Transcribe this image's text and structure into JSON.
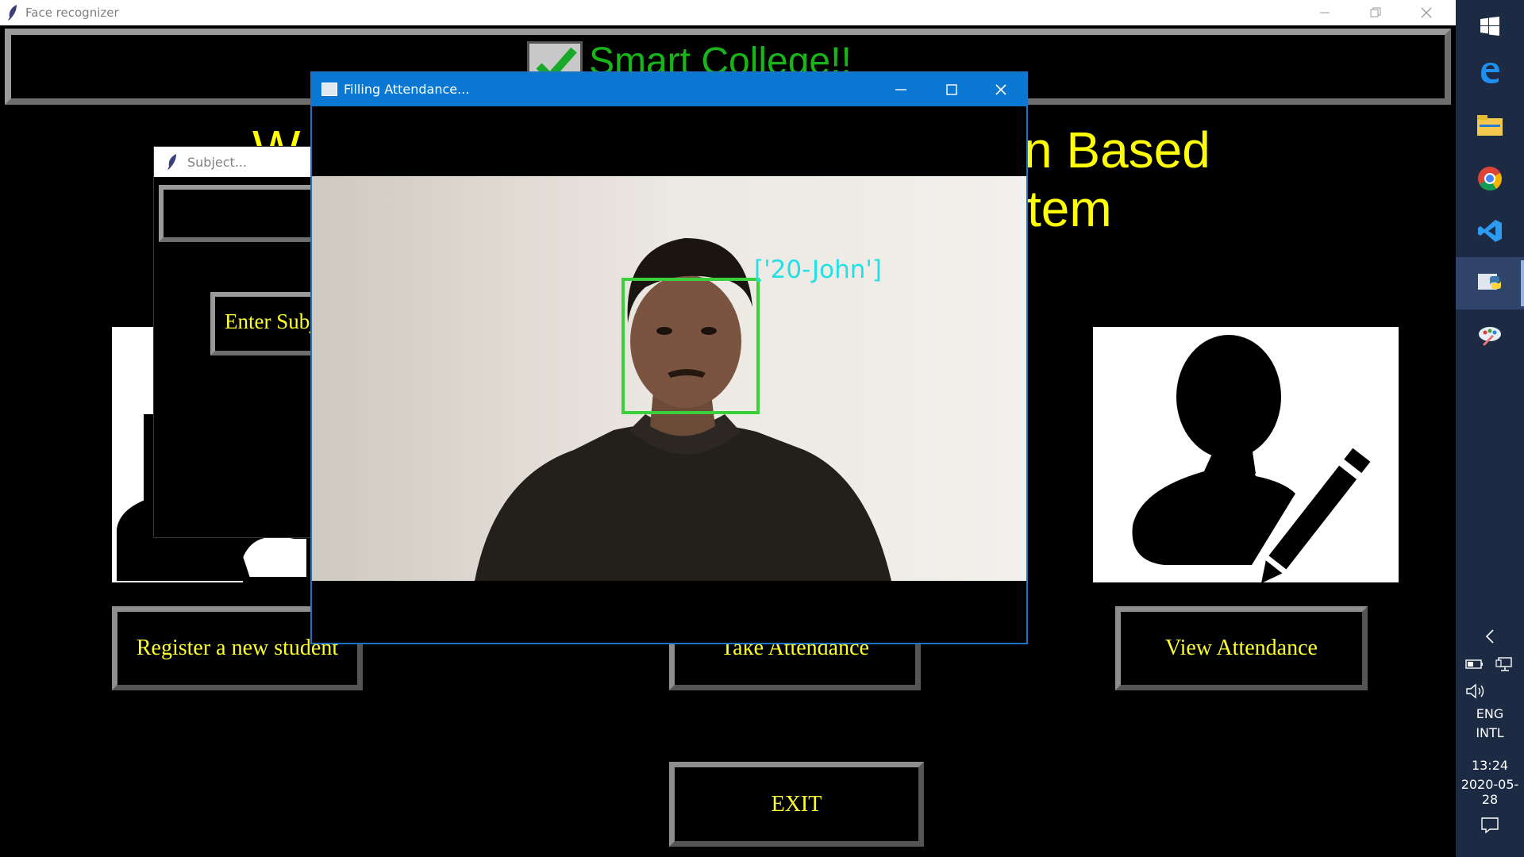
{
  "main_window": {
    "title": "Face recognizer",
    "header_title": "Smart College!!",
    "welcome_left": "W",
    "welcome_right_line1": "n Based",
    "welcome_right_line2": "tem",
    "buttons": {
      "register": "Register a new student",
      "take_attendance": "Take Attendance",
      "view_attendance": "View Attendance",
      "exit": "EXIT"
    }
  },
  "subject_window": {
    "title": "Subject...",
    "button_label": "Enter Subj"
  },
  "attendance_window": {
    "title": "Filling Attendance...",
    "face_label": "['20-John']"
  },
  "taskbar": {
    "apps": [
      "windows-start-icon",
      "edge-icon",
      "file-explorer-icon",
      "chrome-icon",
      "vscode-icon",
      "python-icon",
      "paint-icon"
    ],
    "tray": {
      "language_line1": "ENG",
      "language_line2": "INTL",
      "time": "13:24",
      "date": "2020-05-28"
    }
  },
  "colors": {
    "accent_yellow": "#ffff00",
    "header_green": "#18b41a",
    "face_box_green": "#3ccf3c",
    "face_label_cyan": "#22e0e6",
    "titlebar_blue": "#0a78d2",
    "taskbar": "#1c2a44"
  }
}
